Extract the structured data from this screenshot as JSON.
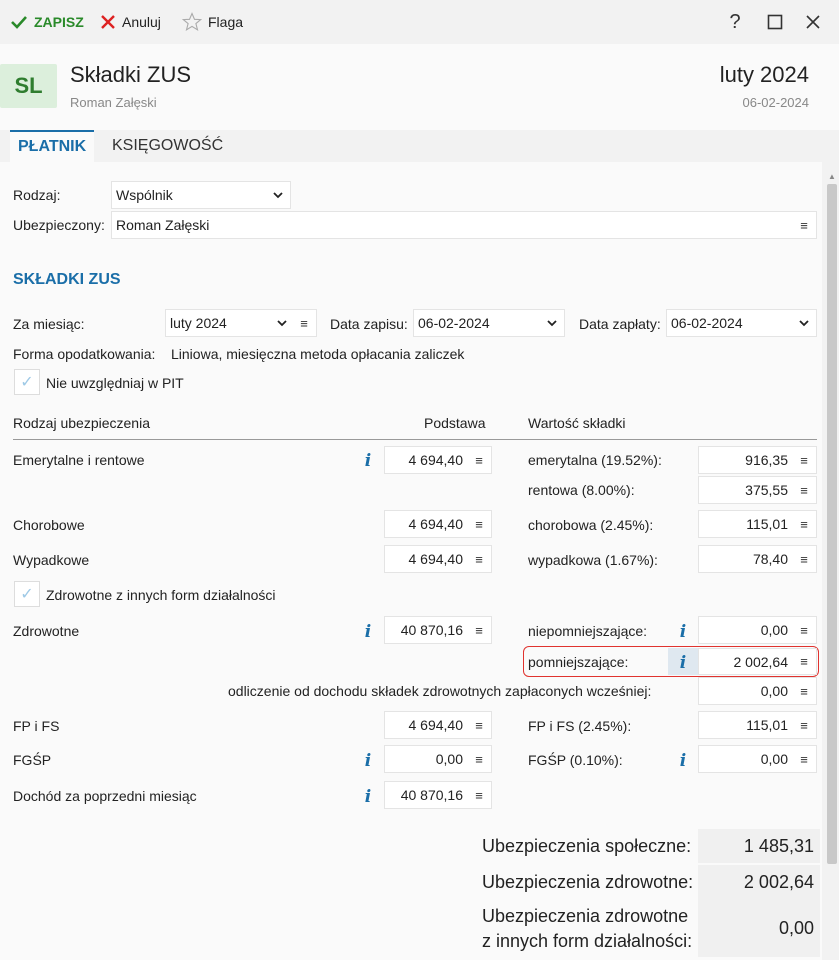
{
  "toolbar": {
    "save_label": "ZAPISZ",
    "cancel_label": "Anuluj",
    "flag_label": "Flaga",
    "help": "?",
    "maximize": "☐",
    "close": "✕"
  },
  "header": {
    "avatar": "SL",
    "title": "Składki ZUS",
    "subtitle": "Roman Załęski",
    "period": "luty 2024",
    "period_date": "06-02-2024"
  },
  "tabs": [
    {
      "label": "PŁATNIK",
      "active": true
    },
    {
      "label": "KSIĘGOWOŚĆ",
      "active": false
    }
  ],
  "form": {
    "rodzaj_label": "Rodzaj:",
    "rodzaj_value": "Wspólnik",
    "ubezpieczony_label": "Ubezpieczony:",
    "ubezpieczony_value": "Roman Załęski"
  },
  "section_title": "SKŁADKI ZUS",
  "dates": {
    "za_miesiac_label": "Za miesiąc:",
    "za_miesiac_value": "luty 2024",
    "data_zapisu_label": "Data zapisu:",
    "data_zapisu_value": "06-02-2024",
    "data_zaplaty_label": "Data zapłaty:",
    "data_zaplaty_value": "06-02-2024"
  },
  "forma": {
    "label": "Forma opodatkowania:",
    "value": "Liniowa, miesięczna metoda opłacania zaliczek"
  },
  "checks": {
    "pit": "Nie uwzględniaj w PIT",
    "zdrowotne_inne": "Zdrowotne z innych form działalności"
  },
  "table_headers": {
    "rodzaj": "Rodzaj ubezpieczenia",
    "podstawa": "Podstawa",
    "wartosc": "Wartość składki"
  },
  "rows": {
    "emerytalne_label": "Emerytalne i rentowe",
    "emerytalne_podstawa": "4 694,40",
    "emerytalna_label": "emerytalna (19.52%):",
    "emerytalna_value": "916,35",
    "rentowa_label": "rentowa (8.00%):",
    "rentowa_value": "375,55",
    "chorobowe_label": "Chorobowe",
    "chorobowe_podstawa": "4 694,40",
    "chorobowa_label": "chorobowa (2.45%):",
    "chorobowa_value": "115,01",
    "wypadkowe_label": "Wypadkowe",
    "wypadkowe_podstawa": "4 694,40",
    "wypadkowa_label": "wypadkowa (1.67%):",
    "wypadkowa_value": "78,40",
    "zdrowotne_label": "Zdrowotne",
    "zdrowotne_podstawa": "40 870,16",
    "niepomniejszajace_label": "niepomniejszające:",
    "niepomniejszajace_value": "0,00",
    "pomniejszajace_label": "pomniejszające:",
    "pomniejszajace_value": "2 002,64",
    "odliczenie_label": "odliczenie od dochodu składek zdrowotnych zapłaconych wcześniej:",
    "odliczenie_value": "0,00",
    "fpfs_label": "FP i FS",
    "fpfs_podstawa": "4 694,40",
    "fpfs_rate_label": "FP i FS (2.45%):",
    "fpfs_value": "115,01",
    "fgsp_label": "FGŚP",
    "fgsp_podstawa": "0,00",
    "fgsp_rate_label": "FGŚP (0.10%):",
    "fgsp_value": "0,00",
    "dochod_label": "Dochód za poprzedni miesiąc",
    "dochod_value": "40 870,16"
  },
  "summary": {
    "spoleczne_label": "Ubezpieczenia społeczne:",
    "spoleczne_value": "1 485,31",
    "zdrowotne_label": "Ubezpieczenia zdrowotne:",
    "zdrowotne_value": "2 002,64",
    "inne_label_1": "Ubezpieczenia zdrowotne",
    "inne_label_2": "z innych form działalności:",
    "inne_value": "0,00"
  },
  "icons": {
    "menu": "≡",
    "chevron": "⌄",
    "info": "i",
    "check": "✓"
  },
  "colors": {
    "accent": "#1a6ea8",
    "save": "#2a8a2a",
    "cancel": "#d22",
    "highlight": "#e0332f"
  }
}
